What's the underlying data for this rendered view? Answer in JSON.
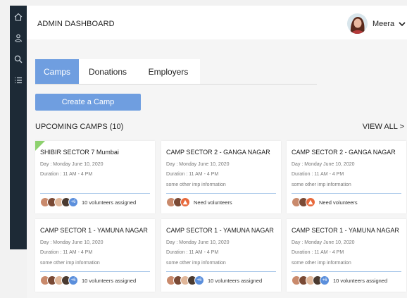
{
  "header": {
    "title": "ADMIN DASHBOARD",
    "user_name": "Meera"
  },
  "sidebar": {
    "icons": [
      "home-icon",
      "users-icon",
      "search-user-icon",
      "list-icon"
    ]
  },
  "tabs": [
    {
      "label": "Camps",
      "active": true
    },
    {
      "label": "Donations",
      "active": false
    },
    {
      "label": "Employers",
      "active": false
    }
  ],
  "create_button": "Create a Camp",
  "section": {
    "title": "UPCOMING CAMPS (10)",
    "view_all": "VIEW ALL >"
  },
  "cards": [
    {
      "title": "SHIBIR SECTOR 7 Mumbai",
      "day": "Day :  Monday  June 10, 2020",
      "duration": "Duration : 11 AM - 4 PM",
      "info": "",
      "footer": "10 volunteers assigned",
      "more_badge": "+6",
      "warning": false,
      "flag": true
    },
    {
      "title": "CAMP SECTOR 2 - GANGA NAGAR",
      "day": "Day :  Monday  June 10, 2020",
      "duration": "Duration : 11 AM - 4 PM",
      "info": "some other imp information",
      "footer": "Need volunteers",
      "more_badge": "",
      "warning": true,
      "flag": false
    },
    {
      "title": "CAMP SECTOR 2 - GANGA NAGAR",
      "day": "Day :  Monday  June 10, 2020",
      "duration": "Duration : 11 AM - 4 PM",
      "info": "some other imp information",
      "footer": "Need volunteers",
      "more_badge": "",
      "warning": true,
      "flag": false
    },
    {
      "title": "CAMP SECTOR 1 - YAMUNA NAGAR",
      "day": "Day :  Monday  June 10, 2020",
      "duration": "Duration : 11 AM - 4 PM",
      "info": "some other imp information",
      "footer": "10 volunteers assigned",
      "more_badge": "+6",
      "warning": false,
      "flag": false
    },
    {
      "title": "CAMP SECTOR 1 - YAMUNA NAGAR",
      "day": "Day :  Monday  June 10, 2020",
      "duration": "Duration : 11 AM - 4 PM",
      "info": "some other imp information",
      "footer": "10 volunteers assigned",
      "more_badge": "+6",
      "warning": false,
      "flag": false
    },
    {
      "title": "CAMP SECTOR 1 - YAMUNA NAGAR",
      "day": "Day :  Monday  June 10, 2020",
      "duration": "Duration : 11 AM - 4 PM",
      "info": "some other imp information",
      "footer": "10 volunteers assigned",
      "more_badge": "+6",
      "warning": false,
      "flag": false
    }
  ],
  "colors": {
    "accent": "#6f9ee0",
    "sidebar": "#1d2a36",
    "flag": "#8dd16e",
    "warning": "#e8693b"
  }
}
